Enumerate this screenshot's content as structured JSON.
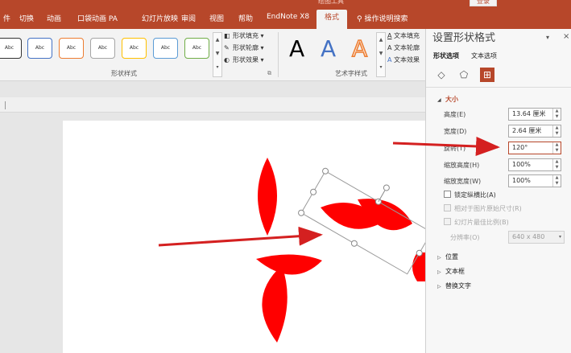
{
  "ribbon": {
    "tabs": [
      "切换",
      "动画",
      "口袋动画 PA",
      "幻灯片放映",
      "审阅",
      "视图",
      "帮助",
      "EndNote X8"
    ],
    "active_tab": "格式",
    "tell_me": "操作说明搜索",
    "shape_style_swatch": "Abc",
    "shape_fill": "形状填充",
    "shape_outline": "形状轮廓",
    "shape_effect": "形状效果",
    "shape_styles_group": "形状样式",
    "wordart_letter": "A",
    "text_fill": "文本填充",
    "text_outline": "文本轮廓",
    "text_effect": "文本效果",
    "wordart_group": "艺术字样式"
  },
  "panel": {
    "title": "设置形状格式",
    "tab_shape": "形状选项",
    "tab_text": "文本选项",
    "section_size": "大小",
    "height_label": "高度(E)",
    "height_value": "13.64 厘米",
    "width_label": "宽度(D)",
    "width_value": "2.64 厘米",
    "rotation_label": "旋转(T)",
    "rotation_value": "120°",
    "scale_h_label": "缩放高度(H)",
    "scale_h_value": "100%",
    "scale_w_label": "缩放宽度(W)",
    "scale_w_value": "100%",
    "lock_ratio": "锁定纵横比(A)",
    "relative_original": "相对于图片原始尺寸(R)",
    "best_scale": "幻灯片最佳比例(B)",
    "resolution_label": "分辨率(O)",
    "resolution_value": "640 x 480",
    "section_position": "位置",
    "section_textbox": "文本框",
    "section_alt_text": "替换文字"
  },
  "colors": {
    "accent": "#b7472a",
    "shape_fill": "#ff0000",
    "arrow": "#d42020"
  }
}
